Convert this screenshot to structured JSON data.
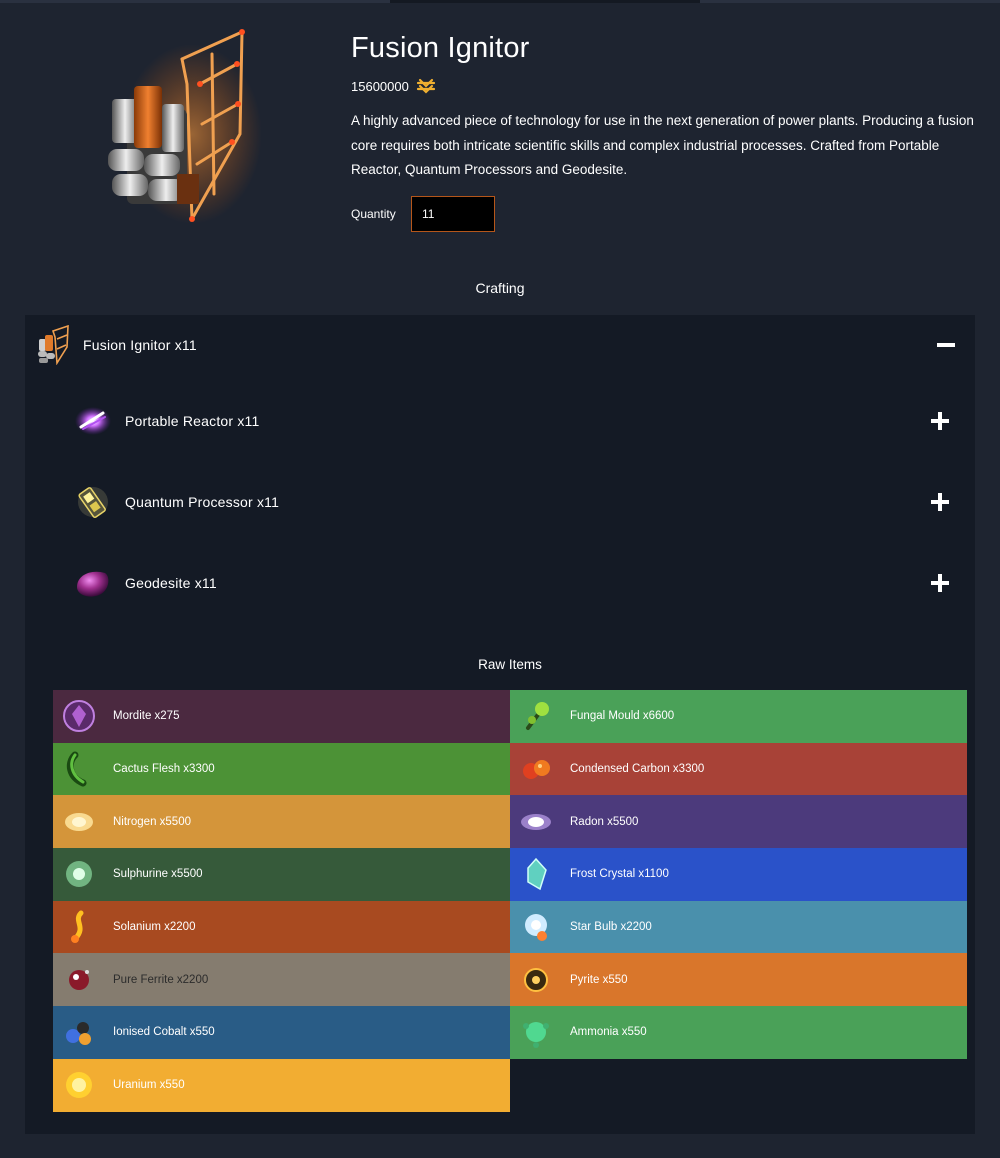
{
  "product": {
    "title": "Fusion Ignitor",
    "price": "15600000",
    "currency_icon": "units-icon",
    "description": "A highly advanced piece of technology for use in the next generation of power plants. Producing a fusion core requires both intricate scientific skills and complex industrial processes. Crafted from Portable Reactor, Quantum Processors and Geodesite.",
    "quantity_label": "Quantity",
    "quantity_value": "11",
    "image_icon": "fusion-ignitor-icon"
  },
  "crafting": {
    "heading": "Crafting",
    "root": {
      "label": "Fusion Ignitor x11",
      "icon": "fusion-ignitor-icon",
      "toggle": "collapse"
    },
    "children": [
      {
        "label": "Portable Reactor x11",
        "icon": "portable-reactor-icon",
        "toggle": "expand"
      },
      {
        "label": "Quantum Processor x11",
        "icon": "quantum-processor-icon",
        "toggle": "expand"
      },
      {
        "label": "Geodesite x11",
        "icon": "geodesite-icon",
        "toggle": "expand"
      }
    ]
  },
  "raw_items": {
    "heading": "Raw Items",
    "items": [
      {
        "label": "Mordite x275",
        "color": "#4b2940",
        "icon": "mordite-icon"
      },
      {
        "label": "Fungal Mould x6600",
        "color": "#4aa158",
        "icon": "fungal-mould-icon"
      },
      {
        "label": "Cactus Flesh x3300",
        "color": "#4c9236",
        "icon": "cactus-flesh-icon"
      },
      {
        "label": "Condensed Carbon x3300",
        "color": "#a84237",
        "icon": "condensed-carbon-icon"
      },
      {
        "label": "Nitrogen x5500",
        "color": "#d4953a",
        "icon": "nitrogen-icon"
      },
      {
        "label": "Radon x5500",
        "color": "#4c3a7c",
        "icon": "radon-icon"
      },
      {
        "label": "Sulphurine x5500",
        "color": "#365a3a",
        "icon": "sulphurine-icon"
      },
      {
        "label": "Frost Crystal x1100",
        "color": "#2a52c9",
        "icon": "frost-crystal-icon"
      },
      {
        "label": "Solanium x2200",
        "color": "#a84a20",
        "icon": "solanium-icon"
      },
      {
        "label": "Star Bulb x2200",
        "color": "#4a90ac",
        "icon": "star-bulb-icon"
      },
      {
        "label": "Pure Ferrite x2200",
        "color": "#857c6f",
        "icon": "pure-ferrite-icon"
      },
      {
        "label": "Pyrite x550",
        "color": "#d9762b",
        "icon": "pyrite-icon"
      },
      {
        "label": "Ionised Cobalt x550",
        "color": "#295c86",
        "icon": "ionised-cobalt-icon"
      },
      {
        "label": "Ammonia x550",
        "color": "#4aa158",
        "icon": "ammonia-icon"
      },
      {
        "label": "Uranium x550",
        "color": "#f2ad32",
        "icon": "uranium-icon"
      }
    ]
  }
}
